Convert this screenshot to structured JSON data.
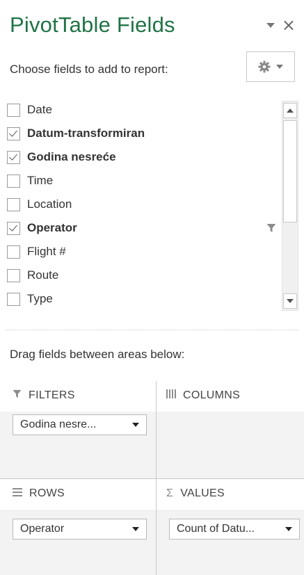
{
  "panel": {
    "title": "PivotTable Fields",
    "choose_label": "Choose fields to add to report:",
    "drag_label": "Drag fields between areas below:",
    "close_glyph": "×"
  },
  "fields": [
    {
      "label": "Date",
      "checked": false,
      "bold": false,
      "filtered": false
    },
    {
      "label": "Datum-transformiran",
      "checked": true,
      "bold": true,
      "filtered": false
    },
    {
      "label": "Godina nesreće",
      "checked": true,
      "bold": true,
      "filtered": false
    },
    {
      "label": "Time",
      "checked": false,
      "bold": false,
      "filtered": false
    },
    {
      "label": "Location",
      "checked": false,
      "bold": false,
      "filtered": false
    },
    {
      "label": "Operator",
      "checked": true,
      "bold": true,
      "filtered": true
    },
    {
      "label": "Flight #",
      "checked": false,
      "bold": false,
      "filtered": false
    },
    {
      "label": "Route",
      "checked": false,
      "bold": false,
      "filtered": false
    },
    {
      "label": "Type",
      "checked": false,
      "bold": false,
      "filtered": false
    }
  ],
  "areas": {
    "filters": {
      "label": "FILTERS",
      "icon": "filter-icon",
      "items": [
        "Godina nesre..."
      ]
    },
    "columns": {
      "label": "COLUMNS",
      "icon": "columns-icon",
      "items": []
    },
    "rows": {
      "label": "ROWS",
      "icon": "rows-icon",
      "items": [
        "Operator"
      ]
    },
    "values": {
      "label": "VALUES",
      "icon": "sigma-icon",
      "glyph": "Σ",
      "items": [
        "Count of Datu..."
      ]
    }
  },
  "colors": {
    "title": "#217346",
    "area_bg": "#f3f3f3"
  }
}
